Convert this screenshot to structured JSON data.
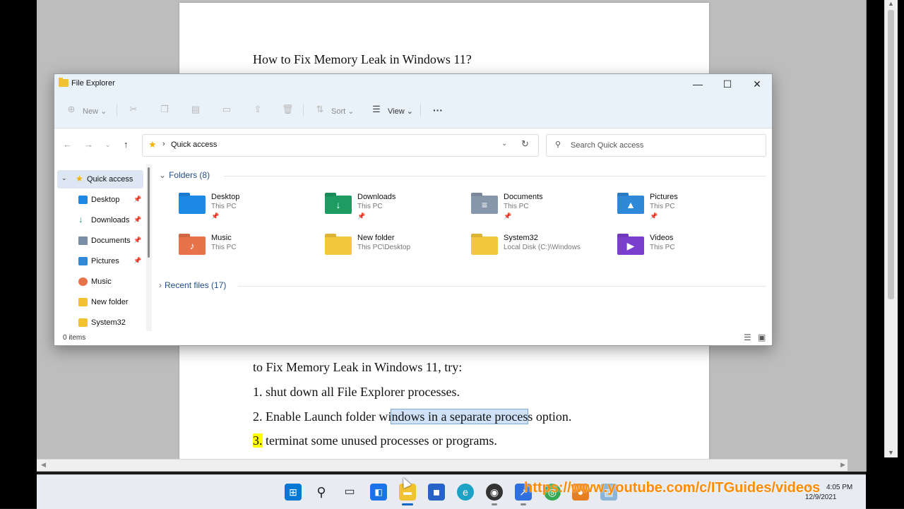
{
  "document": {
    "title_line": "How to Fix Memory Leak in Windows 11?",
    "line1": "to Fix Memory Leak in Windows 11, try:",
    "line2": "1. shut down all File Explorer processes.",
    "line3_pre": "2. Enable Launch folder wi",
    "line3_sel": "ndows in a separate proces",
    "line3_post": "s option.",
    "line4_num": "3.",
    "line4_text": " terminat some unused processes or programs."
  },
  "explorer": {
    "title": "File Explorer",
    "window_buttons": {
      "minimize": "—",
      "maximize": "☐",
      "close": "✕"
    },
    "commands": {
      "new": "New",
      "sort": "Sort",
      "view": "View",
      "more": "···"
    },
    "address": {
      "location": "Quick access",
      "search_placeholder": "Search Quick access"
    },
    "nav": [
      {
        "label": "Quick access",
        "color": "#f2b400"
      },
      {
        "label": "Desktop",
        "color": "#1e88e5"
      },
      {
        "label": "Downloads",
        "color": "#1e9b63"
      },
      {
        "label": "Documents",
        "color": "#7a8fa6"
      },
      {
        "label": "Pictures",
        "color": "#2f88d8"
      },
      {
        "label": "Music",
        "color": "#e8734a"
      },
      {
        "label": "New folder",
        "color": "#f2c230"
      },
      {
        "label": "System32",
        "color": "#f2c230"
      }
    ],
    "folders_header": "Folders (8)",
    "recent_header": "Recent files (17)",
    "folders": [
      {
        "name": "Desktop",
        "sub": "This PC",
        "color": "#1e88e5",
        "glyph": ""
      },
      {
        "name": "Downloads",
        "sub": "This PC",
        "color": "#1e9b63",
        "glyph": "↓"
      },
      {
        "name": "Documents",
        "sub": "This PC",
        "color": "#8797ab",
        "glyph": "≡"
      },
      {
        "name": "Pictures",
        "sub": "This PC",
        "color": "#2f88d8",
        "glyph": "▲"
      },
      {
        "name": "Music",
        "sub": "This PC",
        "color": "#e8734a",
        "glyph": "♪"
      },
      {
        "name": "New folder",
        "sub": "This PC\\Desktop",
        "color": "#f5c73c",
        "glyph": ""
      },
      {
        "name": "System32",
        "sub": "Local Disk (C:)\\Windows",
        "color": "#f5c73c",
        "glyph": ""
      },
      {
        "name": "Videos",
        "sub": "This PC",
        "color": "#7b3fd0",
        "glyph": "▶"
      }
    ],
    "status": {
      "count": "0 items"
    }
  },
  "taskbar": {
    "watermark": "https://www.youtube.com/c/ITGuides/videos",
    "clock_time": "4:05 PM",
    "clock_date": "12/9/2021"
  }
}
